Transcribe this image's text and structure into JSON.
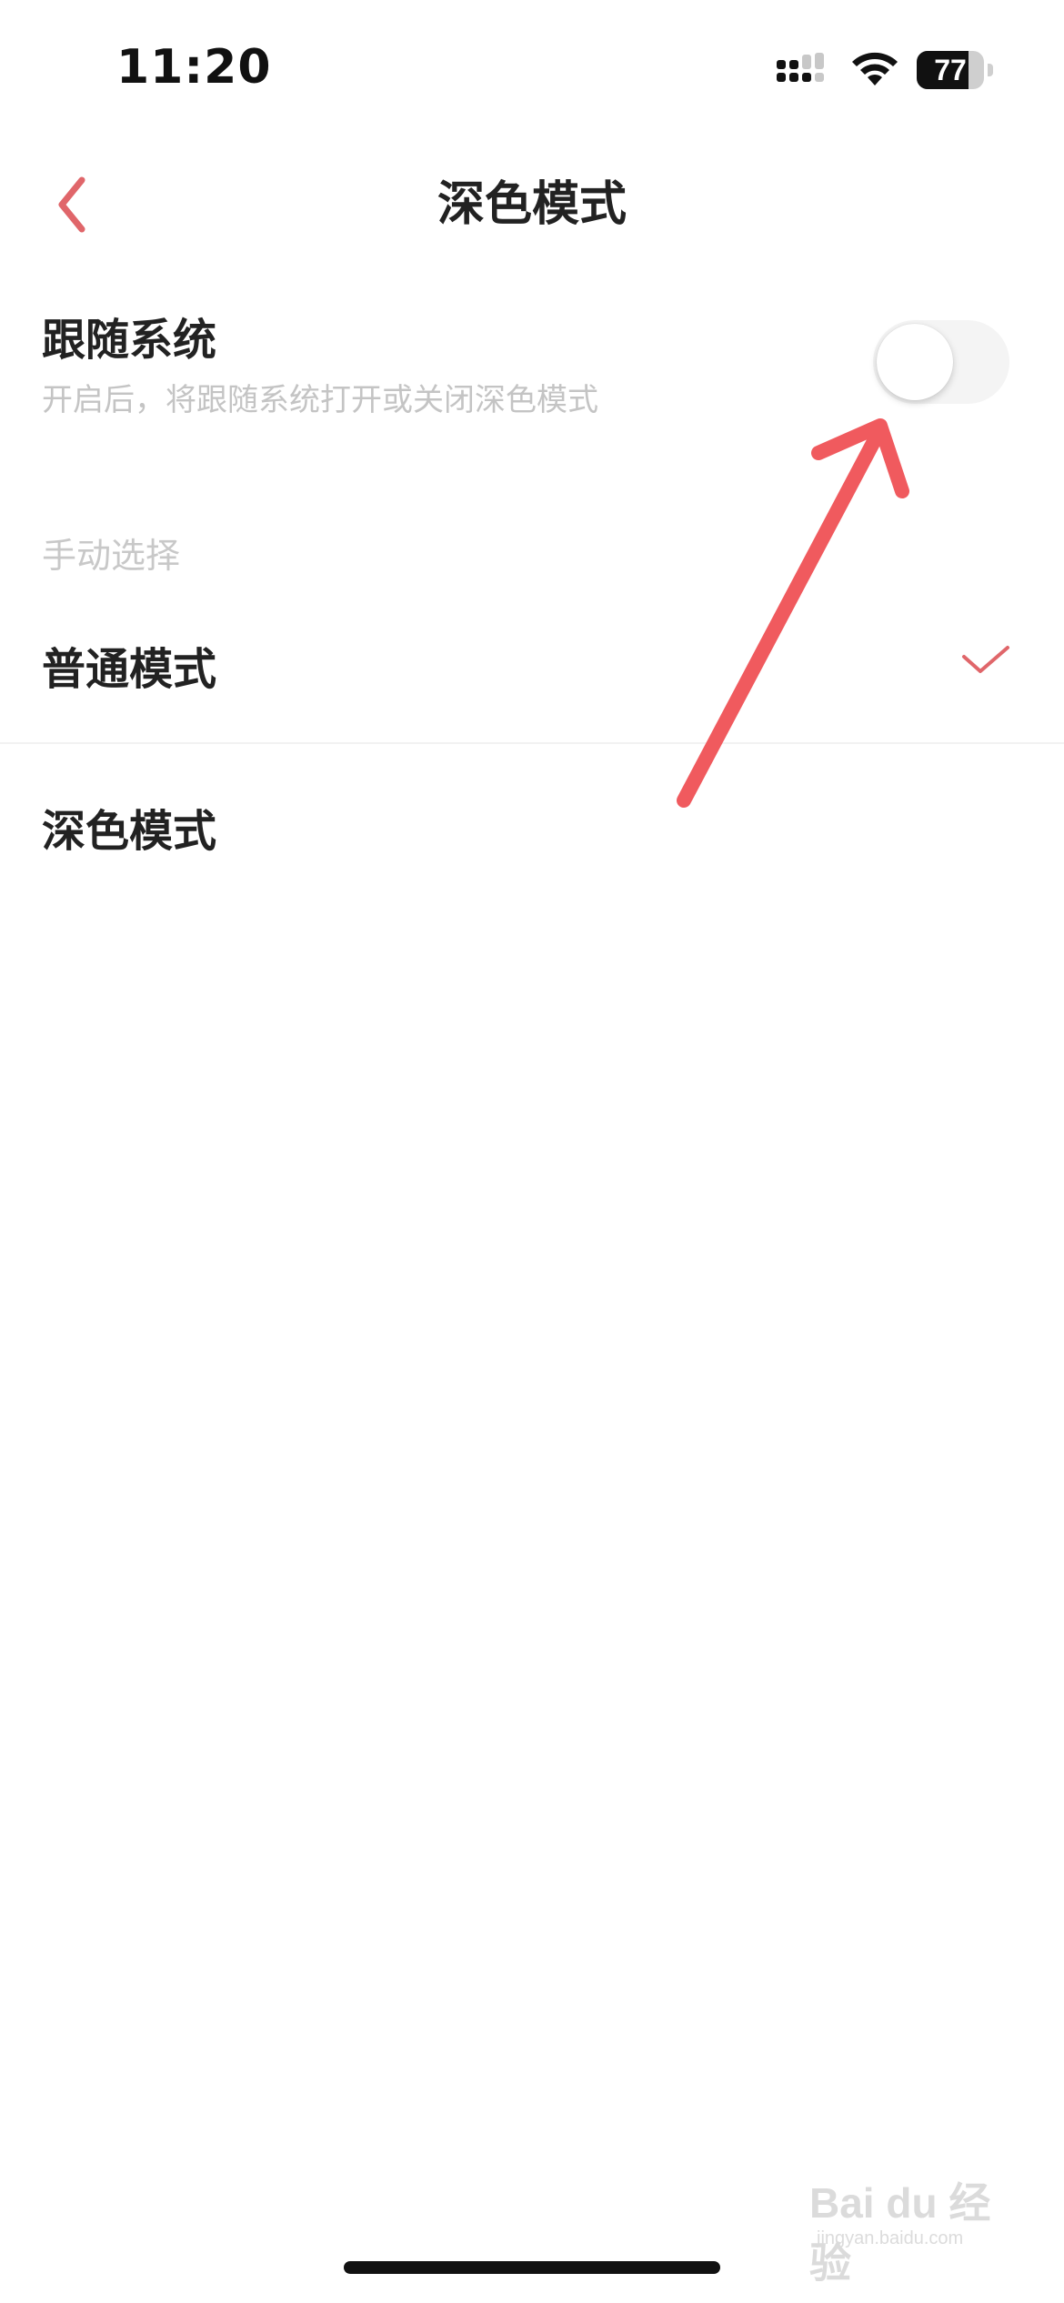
{
  "status_bar": {
    "time": "11:20",
    "battery_percent": "77",
    "battery_level": 0.77,
    "signal_icon": "cellular-signal-icon",
    "wifi_icon": "wifi-icon",
    "battery_icon": "battery-icon"
  },
  "nav": {
    "title": "深色模式",
    "back_icon": "chevron-left-icon"
  },
  "follow_system": {
    "title": "跟随系统",
    "subtitle": "开启后，将跟随系统打开或关闭深色模式",
    "toggle_on": false
  },
  "manual": {
    "section_label": "手动选择",
    "options": [
      {
        "label": "普通模式",
        "selected": true
      },
      {
        "label": "深色模式",
        "selected": false
      }
    ]
  },
  "watermark": {
    "text": "Bai du 经验",
    "sub": "jingyan.baidu.com"
  },
  "colors": {
    "accent": "#e0666a",
    "annotation": "#f05a5e",
    "muted_text": "#c4c4c4"
  }
}
